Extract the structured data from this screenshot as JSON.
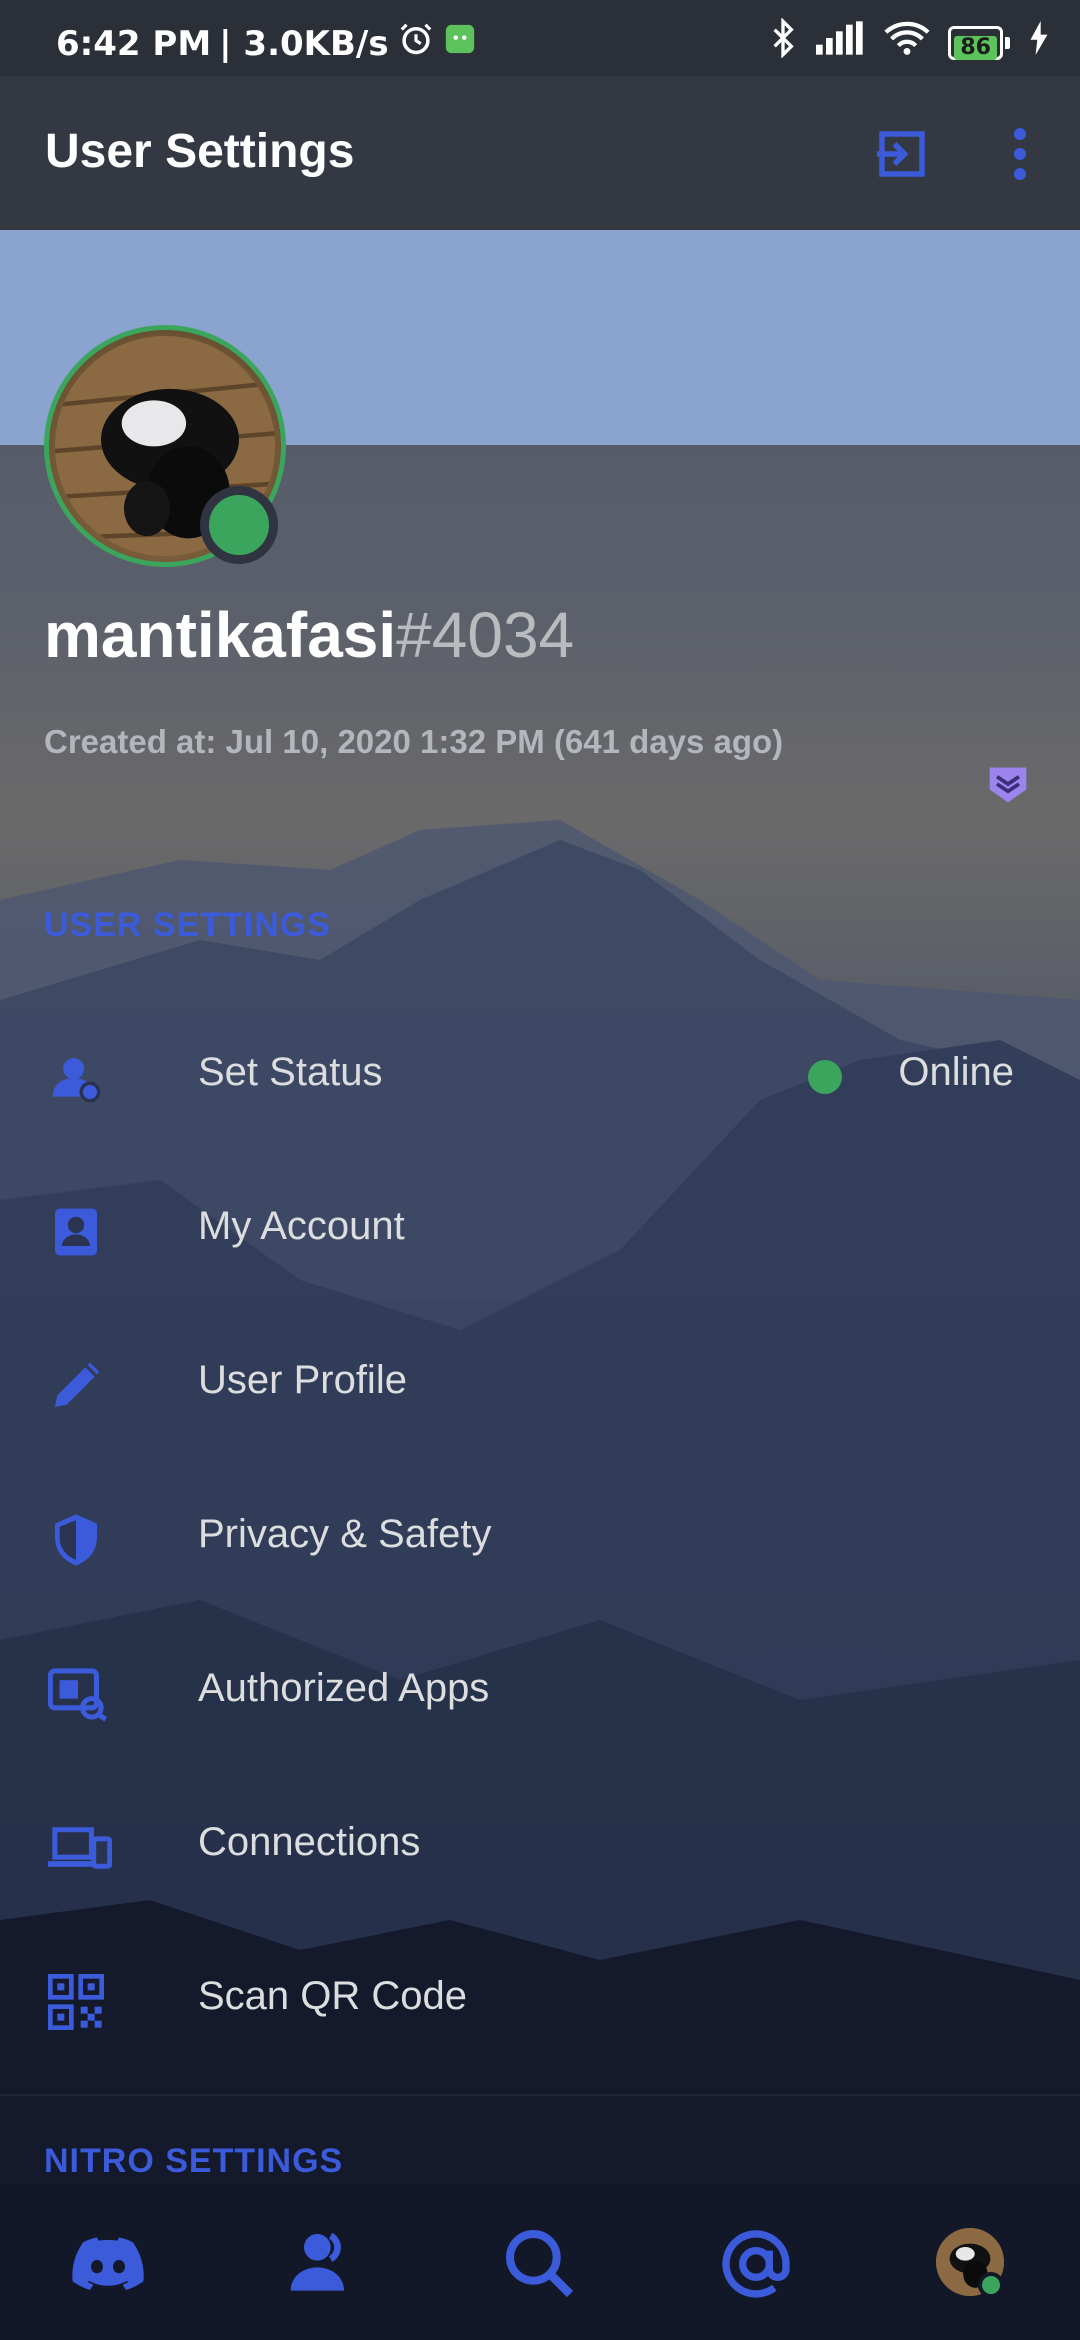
{
  "statusbar": {
    "time": "6:42 PM",
    "speed": "| 3.0KB/s",
    "battery": "86"
  },
  "appbar": {
    "title": "User Settings"
  },
  "profile": {
    "username": "mantikafasi",
    "discriminator": "#4034",
    "created": "Created at: Jul 10, 2020 1:32 PM (641 days ago)"
  },
  "sections": {
    "user_settings": "USER SETTINGS",
    "nitro_settings": "NITRO SETTINGS"
  },
  "menu": [
    {
      "label": "Set Status",
      "value": "Online",
      "icon": "status-icon"
    },
    {
      "label": "My Account",
      "icon": "account-icon"
    },
    {
      "label": "User Profile",
      "icon": "pencil-icon"
    },
    {
      "label": "Privacy & Safety",
      "icon": "shield-icon"
    },
    {
      "label": "Authorized Apps",
      "icon": "apps-icon"
    },
    {
      "label": "Connections",
      "icon": "devices-icon"
    },
    {
      "label": "Scan QR Code",
      "icon": "qr-icon"
    }
  ],
  "colors": {
    "accent": "#3b5bdb",
    "online": "#3ba55d",
    "banner": "#8aa3cf"
  },
  "bottomnav": [
    "discord-icon",
    "friends-icon",
    "search-icon",
    "mentions-icon",
    "profile-avatar"
  ]
}
